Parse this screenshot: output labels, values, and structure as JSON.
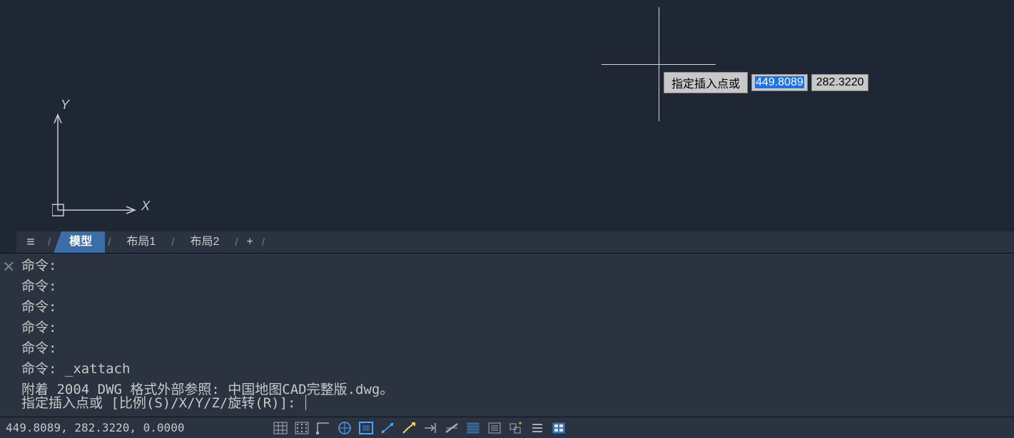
{
  "crosshair": {
    "prompt": "指定插入点或",
    "x_value": "449.8089",
    "y_value": "282.3220"
  },
  "ucs": {
    "x_label": "X",
    "y_label": "Y"
  },
  "tabs": {
    "model": "模型",
    "layout1": "布局1",
    "layout2": "布局2",
    "add": "+",
    "sep": "/"
  },
  "command_history": [
    "命令:",
    "命令:",
    "命令:",
    "命令:",
    "命令:",
    "命令: _xattach",
    "附着 2004 DWG 格式外部参照: 中国地图CAD完整版.dwg。"
  ],
  "command_prompt": "指定插入点或 [比例(S)/X/Y/Z/旋转(R)]: ",
  "status": {
    "coords": "449.8089, 282.3220, 0.0000"
  },
  "icons": {
    "hamburger": "≡",
    "close": "✕"
  },
  "status_icon_names": [
    "grid-icon",
    "snap-icon",
    "osnap-icon",
    "polar-icon",
    "ortho-icon",
    "lineweight-icon",
    "dynamic-icon",
    "extend-icon",
    "line-icon",
    "hatch-icon",
    "list-icon",
    "group-icon",
    "layer-icon",
    "qp-icon"
  ]
}
